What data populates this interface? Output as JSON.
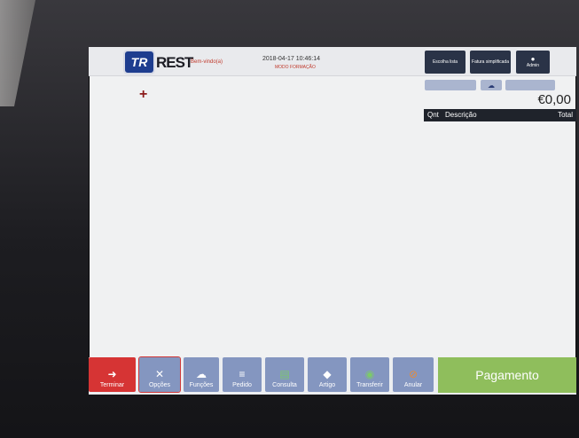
{
  "header": {
    "logo_mark": "TR",
    "logo_text": "REST",
    "welcome": "Bem-vindo(a)",
    "datetime": "2018-04-17  10:46:14",
    "mode": "MODO FORMAÇÃO"
  },
  "top_buttons": {
    "full_list": "Escolha lista",
    "simplified": "Fatura simplificada",
    "admin": "Admin"
  },
  "order": {
    "total": "€0,00",
    "col_qty": "Qnt",
    "col_desc": "Descrição",
    "col_total": "Total",
    "plus": "+"
  },
  "bottom": {
    "terminate": "Terminar",
    "options": "Opções",
    "functions": "Funções",
    "pedido": "Pedido",
    "consulta": "Consulta",
    "artigo": "Artigo",
    "transferir": "Transferir",
    "anular": "Anular",
    "payment": "Pagamento"
  },
  "colors": {
    "accent_blue": "#8496c0",
    "terminate_red": "#d63434",
    "payment_green": "#8fbe5c"
  }
}
